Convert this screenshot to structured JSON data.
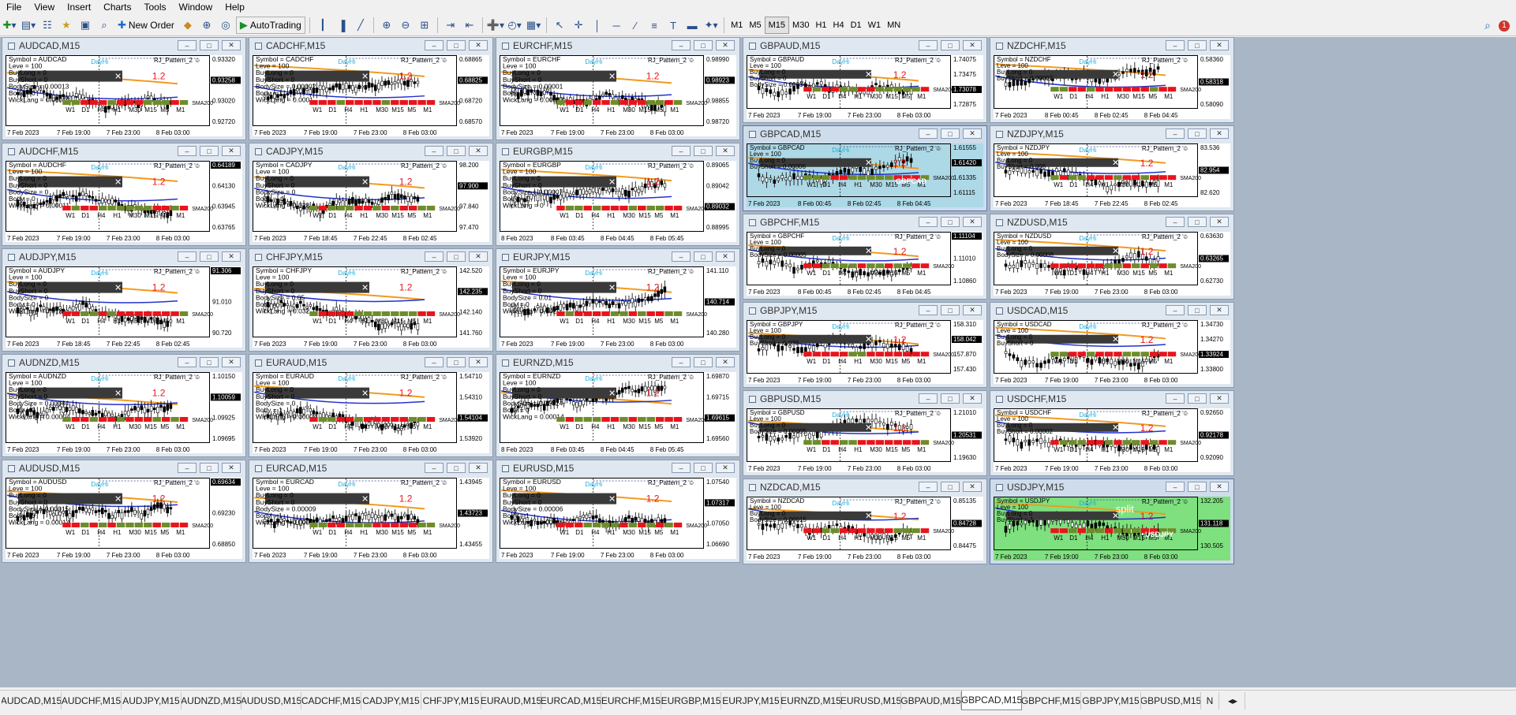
{
  "menu": [
    "File",
    "View",
    "Insert",
    "Charts",
    "Tools",
    "Window",
    "Help"
  ],
  "toolbar": {
    "new_order": "New Order",
    "autotrading": "AutoTrading",
    "timeframes": [
      "M1",
      "M5",
      "M15",
      "M30",
      "H1",
      "H4",
      "D1",
      "W1",
      "MN"
    ],
    "active_tf": "M15",
    "notification_count": "1"
  },
  "indicator": {
    "name": "RJ_Pattern_2",
    "ratio": "1.2",
    "ma_label": "SMA200",
    "dayhi": "DayHi",
    "daylo": "DayLo",
    "lev": "Leve = 100"
  },
  "strip_tfs": [
    "W1",
    "D1",
    "H4",
    "H1",
    "M30",
    "M15",
    "M5",
    "M1"
  ],
  "colors": {
    "orange": "#f29a1e",
    "blue": "#2233cc",
    "red": "#e8141c",
    "green": "#6e8c2a",
    "active_bg": "#add8e6",
    "active_green": "#7ee07e"
  },
  "windows": [
    {
      "title": "AUDCAD,M15",
      "prices": [
        "0.93320",
        "0.93258",
        "0.93020",
        "0.92720"
      ],
      "current": "0.93258",
      "xlabels": [
        "7 Feb 2023",
        "7 Feb 19:00",
        "7 Feb 23:00",
        "8 Feb 03:00"
      ],
      "rows": [
        "Symbol = AUDCAD",
        "Leve = 100",
        "BuyLong = 0",
        "BuyShort = 0",
        "BodySize = 0.00013",
        "Body = 0",
        "WickLang = 0.00012"
      ]
    },
    {
      "title": "CADCHF,M15",
      "prices": [
        "0.68865",
        "0.68825",
        "0.68720",
        "0.68570"
      ],
      "current": "0.68825",
      "xlabels": [
        "7 Feb 2023",
        "7 Feb 19:00",
        "7 Feb 23:00",
        "8 Feb 03:00"
      ],
      "rows": [
        "Symbol = CADCHF",
        "Leve = 100",
        "BuyLong = 0",
        "BuyShort = 0",
        "BodySize = 0.00002",
        "Body = 1",
        "WickLang = 0.0001"
      ]
    },
    {
      "title": "EURCHF,M15",
      "prices": [
        "0.98990",
        "0.98923",
        "0.98855",
        "0.98720"
      ],
      "current": "0.98923",
      "xlabels": [
        "7 Feb 2023",
        "7 Feb 19:00",
        "7 Feb 23:00",
        "8 Feb 03:00"
      ],
      "rows": [
        "Symbol = EURCHF",
        "Leve = 100",
        "BuyLong = 0",
        "BuyShort = 0",
        "BodySize = 0.00001",
        "Body = 0",
        "WickLang = 0.00003"
      ]
    },
    {
      "title": "AUDCHF,M15",
      "prices": [
        "0.64189",
        "0.64130",
        "0.63945",
        "0.63765"
      ],
      "current": "0.64189",
      "xlabels": [
        "7 Feb 2023",
        "7 Feb 19:00",
        "7 Feb 23:00",
        "8 Feb 03:00"
      ],
      "rows": [
        "Symbol = AUDCHF",
        "Leve = 100",
        "BuyLong = 0",
        "BuyShort = 0",
        "BodySize = 0",
        "Body = 0",
        "WickLang = 0.00011"
      ]
    },
    {
      "title": "CADJPY,M15",
      "prices": [
        "98.200",
        "97.900",
        "97.840",
        "97.470"
      ],
      "current": "97.900",
      "xlabels": [
        "7 Feb 2023",
        "7 Feb 18:45",
        "7 Feb 22:45",
        "8 Feb 02:45"
      ],
      "rows": [
        "Symbol = CADJPY",
        "Leve = 100",
        "BuyLong = 0",
        "BuyShort = 0",
        "BodySize = 0",
        "Body = -1",
        "WickLang = 0.028"
      ]
    },
    {
      "title": "EURGBP,M15",
      "prices": [
        "0.89065",
        "0.89042",
        "0.89032",
        "0.88995"
      ],
      "current": "0.89032",
      "xlabels": [
        "8 Feb 2023",
        "8 Feb 03:45",
        "8 Feb 04:45",
        "8 Feb 05:45"
      ],
      "rows": [
        "Symbol = EURGBP",
        "Leve = 100",
        "BuyLong = 0",
        "BuyShort = 0",
        "BodySize = 0.00007",
        "Body = 1",
        "WickLang = 0"
      ]
    },
    {
      "title": "AUDJPY,M15",
      "prices": [
        "91.306",
        "91.010",
        "90.720"
      ],
      "current": "91.306",
      "xlabels": [
        "7 Feb 2023",
        "7 Feb 18:45",
        "7 Feb 22:45",
        "8 Feb 02:45"
      ],
      "rows": [
        "Symbol = AUDJPY",
        "Leve = 100",
        "BuyLong = 0",
        "BuyShort = 0",
        "BodySize = 0",
        "Body = 0",
        "WickLang = 0.018"
      ]
    },
    {
      "title": "CHFJPY,M15",
      "prices": [
        "142.520",
        "142.235",
        "142.140",
        "141.760"
      ],
      "current": "142.235",
      "xlabels": [
        "7 Feb 2023",
        "7 Feb 19:00",
        "7 Feb 23:00",
        "8 Feb 03:00"
      ],
      "rows": [
        "Symbol = CHFJPY",
        "Leve = 100",
        "BuyLong = 0",
        "BuyShort = 0",
        "BodySize = 0.05",
        "Body = -1",
        "WickLang = 0.032"
      ]
    },
    {
      "title": "EURJPY,M15",
      "prices": [
        "141.110",
        "140.714",
        "140.280"
      ],
      "current": "140.714",
      "xlabels": [
        "7 Feb 2023",
        "7 Feb 19:00",
        "7 Feb 23:00",
        "8 Feb 03:00"
      ],
      "rows": [
        "Symbol = EURJPY",
        "Leve = 100",
        "BuyLong = 0",
        "BuyShort = 0",
        "BodySize = 0.01",
        "Body = 0",
        "WickLang = 0.042"
      ]
    },
    {
      "title": "AUDNZD,M15",
      "prices": [
        "1.10150",
        "1.10059",
        "1.09925",
        "1.09695"
      ],
      "current": "1.10059",
      "xlabels": [
        "7 Feb 2023",
        "7 Feb 19:00",
        "7 Feb 23:00",
        "8 Feb 03:00"
      ],
      "rows": [
        "Symbol = AUDNZD",
        "Leve = 100",
        "BuyLong = 0",
        "BuyShort = 0",
        "BodySize = 0.00044",
        "Body = 0",
        "WickLang = 0.00004"
      ]
    },
    {
      "title": "EURAUD,M15",
      "prices": [
        "1.54710",
        "1.54310",
        "1.54104",
        "1.53920"
      ],
      "current": "1.54104",
      "xlabels": [
        "7 Feb 2023",
        "7 Feb 19:00",
        "7 Feb 23:00",
        "8 Feb 03:00"
      ],
      "rows": [
        "Symbol = EURAUD",
        "Leve = 100",
        "BuyLong = 0",
        "BuyShort = 0",
        "BodySize = 0",
        "Body = 1",
        "WickLang = 0.00004"
      ]
    },
    {
      "title": "EURNZD,M15",
      "prices": [
        "1.69870",
        "1.69715",
        "1.69615",
        "1.69560"
      ],
      "current": "1.69615",
      "xlabels": [
        "8 Feb 2023",
        "8 Feb 03:45",
        "8 Feb 04:45",
        "8 Feb 05:45"
      ],
      "rows": [
        "Symbol = EURNZD",
        "Leve = 100",
        "BuyLong = 0",
        "BuyShort = 0",
        "BodySize = 0.00024",
        "Body = 0",
        "WickLang = 0.00014"
      ]
    },
    {
      "title": "AUDUSD,M15",
      "prices": [
        "0.69634",
        "0.69230",
        "0.68850"
      ],
      "current": "0.69634",
      "xlabels": [
        "7 Feb 2023",
        "7 Feb 19:00",
        "7 Feb 23:00",
        "8 Feb 03:00"
      ],
      "rows": [
        "Symbol = AUDUSD",
        "Leve = 100",
        "BuyLong = 0",
        "BuyShort = 0",
        "BodySize = 0.00015",
        "Body = 0",
        "WickLang = 0.00014"
      ]
    },
    {
      "title": "EURCAD,M15",
      "prices": [
        "1.43945",
        "1.43723",
        "1.43455"
      ],
      "current": "1.43723",
      "xlabels": [
        "7 Feb 2023",
        "7 Feb 19:00",
        "7 Feb 23:00",
        "8 Feb 03:00"
      ],
      "rows": [
        "Symbol = EURCAD",
        "Leve = 100",
        "BuyLong = 0",
        "BuyShort = 0",
        "BodySize = 0.00009",
        "Body = 1",
        "WickLang = 0.0001"
      ]
    },
    {
      "title": "EURUSD,M15",
      "prices": [
        "1.07540",
        "1.07317",
        "1.07050",
        "1.06690"
      ],
      "current": "1.07317",
      "xlabels": [
        "7 Feb 2023",
        "7 Feb 19:00",
        "7 Feb 23:00",
        "8 Feb 03:00"
      ],
      "rows": [
        "Symbol = EURUSD",
        "Leve = 100",
        "BuyLong = 0",
        "BuyShort = 0",
        "BodySize = 0.00006",
        "Body = 1",
        "WickLang = 0.00026"
      ]
    },
    {
      "title": "GBPAUD,M15",
      "prices": [
        "1.74075",
        "1.73475",
        "1.73078",
        "1.72875"
      ],
      "current": "1.73078",
      "xlabels": [
        "7 Feb 2023",
        "7 Feb 19:00",
        "7 Feb 23:00",
        "8 Feb 03:00"
      ],
      "rows": [
        "Symbol = GBPAUD",
        "Leve = 100",
        "BuyLong = 0",
        "BuyShort = 0",
        "BodySize = 0.00034"
      ]
    },
    {
      "title": "NZDCHF,M15",
      "prices": [
        "0.58360",
        "0.58318",
        "0.58090"
      ],
      "current": "0.58318",
      "xlabels": [
        "7 Feb 2023",
        "8 Feb 00:45",
        "8 Feb 02:45",
        "8 Feb 04:45"
      ],
      "rows": [
        "Symbol = NZDCHF",
        "Leve = 100",
        "BuyLong = 0",
        "BuyShort = 0.00007"
      ]
    },
    {
      "title": "GBPCAD,M15",
      "prices": [
        "1.61555",
        "1.61420",
        "1.61335",
        "1.61115"
      ],
      "current": "1.61420",
      "xlabels": [
        "7 Feb 2023",
        "8 Feb 00:45",
        "8 Feb 02:45",
        "8 Feb 04:45"
      ],
      "rows": [
        "Symbol = GBPCAD",
        "Leve = 100",
        "BuyLong = 0",
        "BuyShort = 0.00006"
      ],
      "watermark": "GBPCAD"
    },
    {
      "title": "NZDJPY,M15",
      "prices": [
        "83.536",
        "82.954",
        "82.620"
      ],
      "current": "82.954",
      "xlabels": [
        "7 Feb 2023",
        "7 Feb 18:45",
        "7 Feb 22:45",
        "8 Feb 02:45"
      ],
      "rows": [
        "Symbol = NZDJPY",
        "Leve = 100",
        "BuyLong = 0",
        "BuyShort = 0.008"
      ]
    },
    {
      "title": "GBPCHF,M15",
      "prices": [
        "1.11104",
        "1.11010",
        "1.10860"
      ],
      "current": "1.11104",
      "xlabels": [
        "7 Feb 2023",
        "8 Feb 00:45",
        "8 Feb 02:45",
        "8 Feb 04:45"
      ],
      "rows": [
        "Symbol = GBPCHF",
        "Leve = 100",
        "BuyLong = 0",
        "BodySize = 0.00005"
      ]
    },
    {
      "title": "NZDUSD,M15",
      "prices": [
        "0.63630",
        "0.63265",
        "0.62730"
      ],
      "current": "0.63265",
      "xlabels": [
        "7 Feb 2023",
        "7 Feb 19:00",
        "7 Feb 23:00",
        "8 Feb 03:00"
      ],
      "rows": [
        "Symbol = NZDUSD",
        "Leve = 100",
        "BuyLong = 0",
        "BodySize = 0.00008"
      ]
    },
    {
      "title": "GBPJPY,M15",
      "prices": [
        "158.310",
        "158.042",
        "157.870",
        "157.430"
      ],
      "current": "158.042",
      "xlabels": [
        "7 Feb 2023",
        "7 Feb 19:00",
        "7 Feb 23:00",
        "8 Feb 03:00"
      ],
      "rows": [
        "Symbol = GBPJPY",
        "Leve = 100",
        "BuyLong = 0",
        "BuyShort = 0.038"
      ]
    },
    {
      "title": "USDCAD,M15",
      "prices": [
        "1.34730",
        "1.34270",
        "1.33924",
        "1.33800"
      ],
      "current": "1.33924",
      "xlabels": [
        "7 Feb 2023",
        "7 Feb 19:00",
        "7 Feb 23:00",
        "8 Feb 03:00"
      ],
      "rows": [
        "Symbol = USDCAD",
        "Leve = 100",
        "BuyLong = 0",
        "BuyShort = 0"
      ]
    },
    {
      "title": "GBPUSD,M15",
      "prices": [
        "1.21010",
        "1.20531",
        "1.19630"
      ],
      "current": "1.20531",
      "xlabels": [
        "7 Feb 2023",
        "7 Feb 19:00",
        "7 Feb 23:00",
        "8 Feb 03:00"
      ],
      "rows": [
        "Symbol = GBPUSD",
        "Leve = 100",
        "BuyLong = 0",
        "BodySize = 0.00005"
      ]
    },
    {
      "title": "USDCHF,M15",
      "prices": [
        "0.92650",
        "0.92178",
        "0.92090"
      ],
      "current": "0.92178",
      "xlabels": [
        "7 Feb 2023",
        "7 Feb 19:00",
        "7 Feb 23:00",
        "8 Feb 03:00"
      ],
      "rows": [
        "Symbol = USDCHF",
        "Leve = 100",
        "BuyLong = 0",
        "BuyShort = 0.00002"
      ]
    },
    {
      "title": "NZDCAD,M15",
      "prices": [
        "0.85135",
        "0.84728",
        "0.84475"
      ],
      "current": "0.84728",
      "xlabels": [
        "7 Feb 2023",
        "7 Feb 19:00",
        "7 Feb 23:00",
        "8 Feb 03:00"
      ],
      "rows": [
        "Symbol = NZDCAD",
        "Leve = 100",
        "BuyLong = 0",
        "BodySize = 0.00015"
      ]
    },
    {
      "title": "USDJPY,M15",
      "prices": [
        "132.205",
        "131.118",
        "130.505"
      ],
      "current": "131.118",
      "xlabels": [
        "7 Feb 2023",
        "7 Feb 19:00",
        "7 Feb 23:00",
        "8 Feb 03:00"
      ],
      "rows": [
        "Symbol = USDJPY",
        "Leve = 100",
        "BuyLong = 0",
        "BuyShort = 1"
      ],
      "watermark": "USDJPY",
      "split": "split"
    }
  ],
  "tabs": [
    "AUDCAD,M15",
    "AUDCHF,M15",
    "AUDJPY,M15",
    "AUDNZD,M15",
    "AUDUSD,M15",
    "CADCHF,M15",
    "CADJPY,M15",
    "CHFJPY,M15",
    "EURAUD,M15",
    "EURCAD,M15",
    "EURCHF,M15",
    "EURGBP,M15",
    "EURJPY,M15",
    "EURNZD,M15",
    "EURUSD,M15",
    "GBPAUD,M15",
    "GBPCAD,M15",
    "GBPCHF,M15",
    "GBPJPY,M15",
    "GBPUSD,M15",
    "N"
  ],
  "selected_tab": "GBPCAD,M15"
}
